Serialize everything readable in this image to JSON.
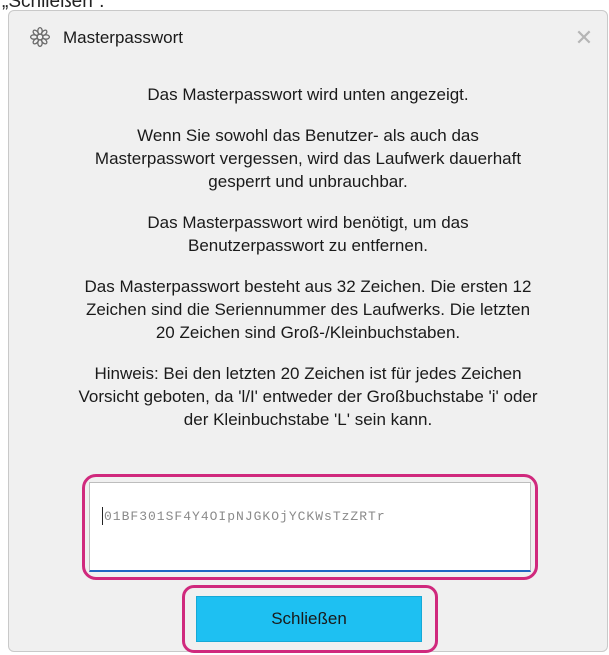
{
  "header_caption": "„Schließen“.",
  "dialog": {
    "title": "Masterpasswort",
    "icon": "gear-flower-icon",
    "close_glyph": "✕",
    "paragraphs": [
      [
        "Das Masterpasswort wird unten angezeigt."
      ],
      [
        "Wenn Sie sowohl das Benutzer- als auch das",
        "Masterpasswort vergessen, wird das Laufwerk dauerhaft",
        "gesperrt und unbrauchbar."
      ],
      [
        "Das Masterpasswort wird benötigt, um das",
        "Benutzerpasswort zu entfernen."
      ],
      [
        "Das Masterpasswort besteht aus 32 Zeichen. Die ersten 12",
        "Zeichen sind die Seriennummer des Laufwerks. Die letzten",
        "20 Zeichen sind Groß-/Kleinbuchstaben."
      ],
      [
        "Hinweis: Bei den letzten 20 Zeichen ist für jedes Zeichen",
        "Vorsicht geboten, da 'l/I' entweder der Großbuchstabe 'i' oder",
        "der Kleinbuchstabe 'L' sein kann."
      ]
    ],
    "password_value": "01BF301SF4Y4OIpNJGKOjYCKWsTzZRTr",
    "close_button_label": "Schließen"
  },
  "colors": {
    "highlight": "#d0297d",
    "button": "#1ec0f2",
    "field_underline": "#1f66c4"
  }
}
